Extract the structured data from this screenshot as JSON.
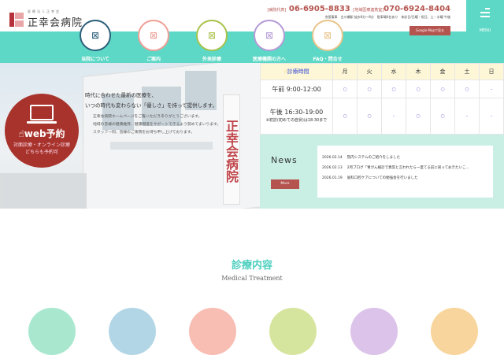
{
  "header": {
    "logo_sub": "医療法人正幸会",
    "logo_name": "正幸会病院",
    "tel_label": "[病院代表]",
    "tel": "06-6905-8833",
    "tel2_label": "[地域医療連携室]",
    "tel2": "070-6924-8404",
    "access": "京阪電車　古川橋駅 徒歩6分〜8分　駐車場4台あり　休診日/日曜・祝日、土・水曜 午後",
    "map_button": "Google Mapで見る",
    "menu_label": "MENU"
  },
  "nav": [
    {
      "label": "当院について",
      "color": "#2d5f7a"
    },
    {
      "label": "ご案内",
      "color": "#ef9f97"
    },
    {
      "label": "外来診療",
      "color": "#a8c24a"
    },
    {
      "label": "医療機関の方へ",
      "color": "#b49ad6"
    },
    {
      "label": "FAQ・問合せ",
      "color": "#e9c48a"
    }
  ],
  "hero": {
    "sign": "正幸会病院",
    "web_title": "web予約",
    "web_sub1": "対面診療・オンライン診療",
    "web_sub2": "どちらも予約可",
    "catch1": "時代に合わせた最新の医療を、",
    "catch2": "いつの時代も変わらない「優しさ」を持って提供します。",
    "body1": "正幸会病院ホームページをご覧いただきありがとうございます。",
    "body2": "地域の皆様の健康維持、健康増進をサポートできるよう努めてまいります。",
    "body3": "スタッフ一同、皆様のご来院をお待ち申し上げております。"
  },
  "hours": {
    "title": "診療時間",
    "days": [
      "月",
      "火",
      "水",
      "木",
      "金",
      "土",
      "日"
    ],
    "rows": [
      {
        "label": "午前 9:00-12:00",
        "note": "",
        "cells": [
          "○",
          "○",
          "○",
          "○",
          "○",
          "○",
          "-"
        ]
      },
      {
        "label": "午後 16:30-19:00",
        "note": "※初診(初めての症状)は18:30まで",
        "cells": [
          "○",
          "○",
          "-",
          "○",
          "○",
          "-",
          "-"
        ]
      }
    ]
  },
  "news": {
    "title": "News",
    "more": "More",
    "items": [
      {
        "date": "2026.02.14",
        "text": "院内システムのご紹介をしました"
      },
      {
        "date": "2026.02.13",
        "text": "2月ブログ「胃がん検診で異常と言われたら一度てる前に知っておきたいこ…"
      },
      {
        "date": "2026.01.19",
        "text": "歯科口腔ケアについての勉強会を行いました"
      }
    ]
  },
  "section": {
    "title": "診療内容",
    "subtitle": "Medical Treatment"
  },
  "treatment_colors": [
    "#a9e8cf",
    "#b3d6e6",
    "#f8bdb3",
    "#d6e59e",
    "#dcc3ea",
    "#f7d59c"
  ]
}
